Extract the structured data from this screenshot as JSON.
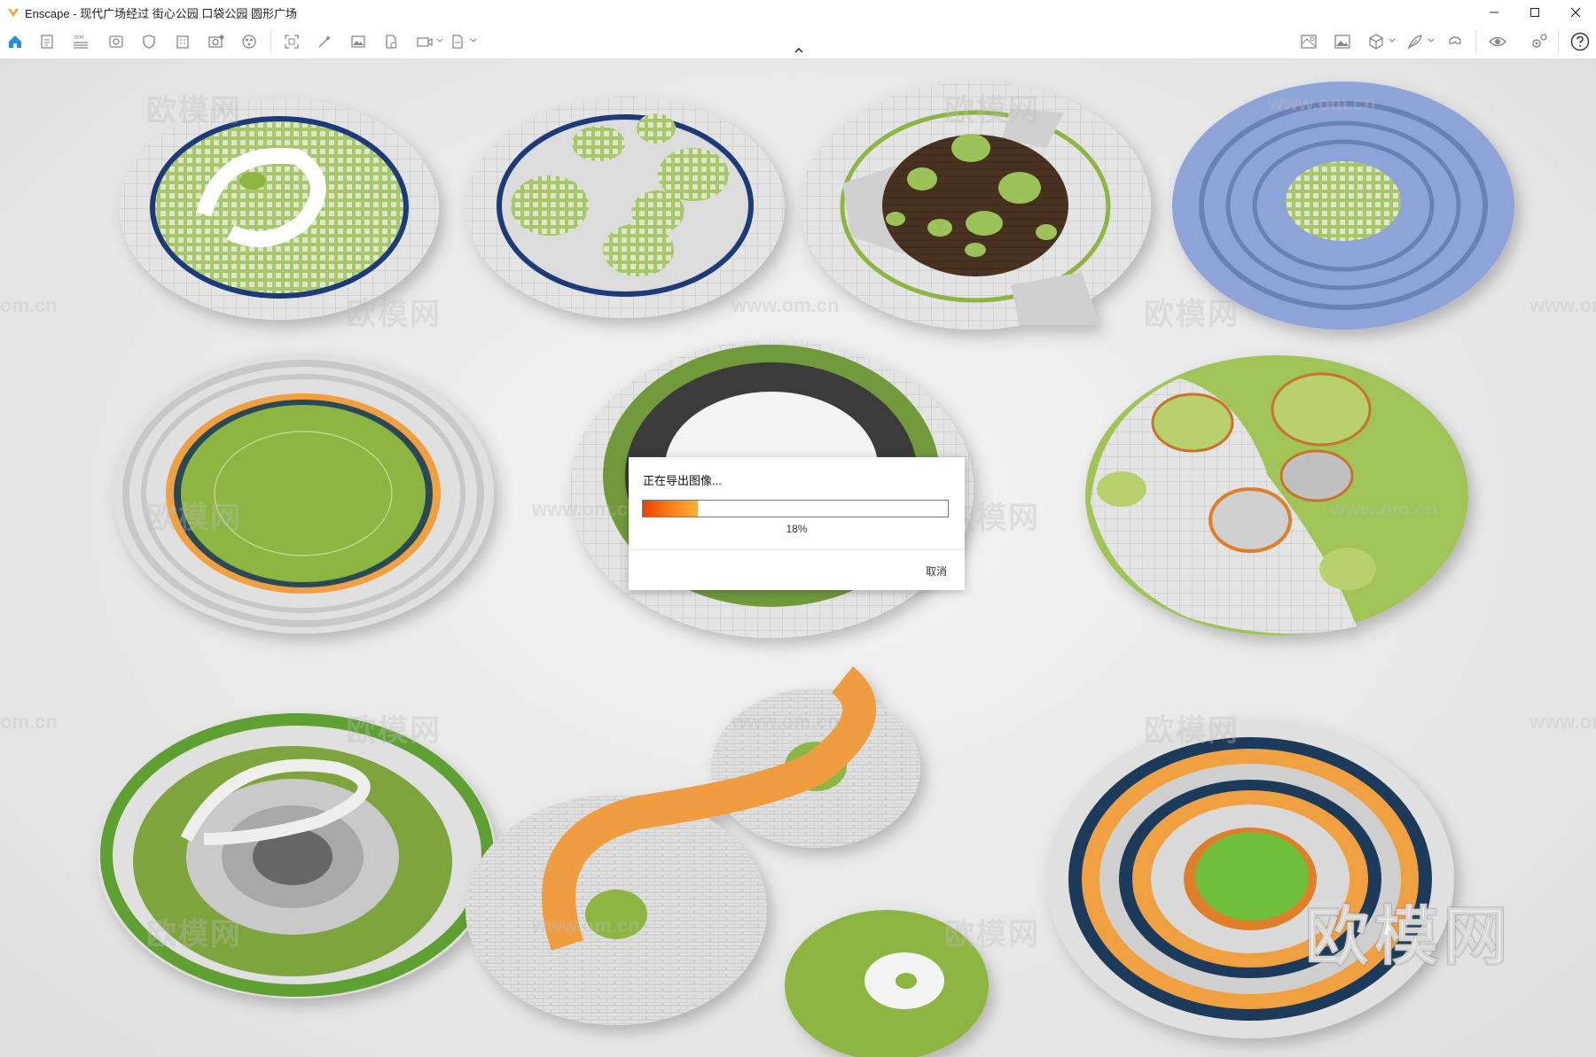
{
  "window": {
    "title": "Enscape - 现代广场经过 街心公园 口袋公园 圆形广场",
    "controls": [
      "minimize-icon",
      "maximize-icon",
      "close-icon"
    ]
  },
  "toolbar": {
    "left_icons": [
      "home-icon",
      "document-icon",
      "bim-icon",
      "view-icon",
      "shield-icon",
      "building-icon",
      "camera-info-icon",
      "asset-library-icon",
      "screenshot-icon",
      "magic-wand-icon",
      "image-icon",
      "export-file-icon",
      "video-export-icon",
      "batch-export-icon"
    ],
    "right_icons": [
      "map-icon",
      "panorama-icon",
      "cube-view-icon",
      "feather-icon",
      "vr-headset-icon",
      "visibility-icon",
      "settings-icon",
      "help-icon"
    ],
    "bim_label": "BIM"
  },
  "dialog": {
    "title": "正在导出图像...",
    "progress_percent": 18,
    "progress_label": "18%",
    "cancel_label": "取消"
  },
  "watermarks": {
    "brand": "欧模网",
    "url": "www.om.cn",
    "url_short": "om.cn",
    "large_brand": "欧模网"
  },
  "colors": {
    "grass": "#8db542",
    "navy": "#1e3a78",
    "orange": "#f0a040",
    "periwinkle": "#8ea4d8",
    "paving": "#d9d9d9",
    "accent_orange": "#f07010"
  }
}
